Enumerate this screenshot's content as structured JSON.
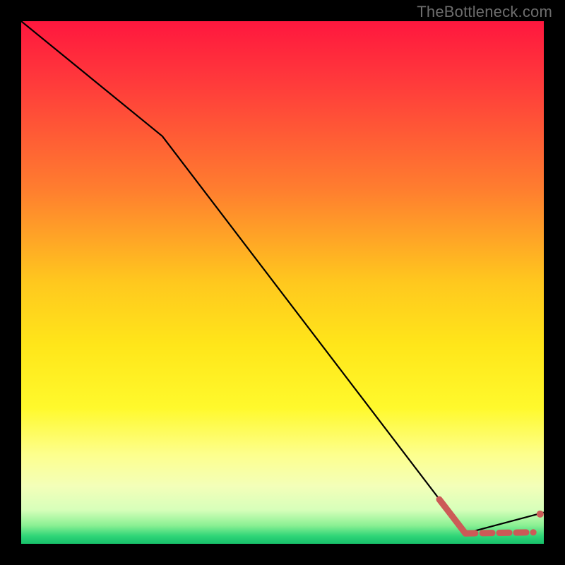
{
  "watermark": "TheBottleneck.com",
  "chart_data": {
    "type": "line",
    "title": "",
    "xlabel": "",
    "ylabel": "",
    "xlim": [
      0,
      100
    ],
    "ylim": [
      0,
      100
    ],
    "series": [
      {
        "name": "black-curve",
        "style": "solid",
        "color": "#000000",
        "x": [
          0,
          27,
          85,
          100
        ],
        "y": [
          100,
          78,
          2,
          6
        ]
      },
      {
        "name": "red-segment",
        "style": "solid-thick",
        "color": "#cc5a57",
        "x": [
          80,
          85
        ],
        "y": [
          8.5,
          2
        ]
      },
      {
        "name": "red-dashed",
        "style": "dashed-thick",
        "color": "#cc5a57",
        "x": [
          85,
          98
        ],
        "y": [
          2,
          2.2
        ]
      },
      {
        "name": "red-end-dot",
        "style": "dot",
        "color": "#cc5a57",
        "x": [
          99.3
        ],
        "y": [
          5.7
        ]
      }
    ],
    "gradient_stops": [
      {
        "offset": 0.0,
        "color": "#ff173e"
      },
      {
        "offset": 0.12,
        "color": "#ff3b3b"
      },
      {
        "offset": 0.32,
        "color": "#ff7d2f"
      },
      {
        "offset": 0.5,
        "color": "#ffc81e"
      },
      {
        "offset": 0.62,
        "color": "#ffe61a"
      },
      {
        "offset": 0.74,
        "color": "#fff92c"
      },
      {
        "offset": 0.83,
        "color": "#fdff8e"
      },
      {
        "offset": 0.89,
        "color": "#f3ffb9"
      },
      {
        "offset": 0.935,
        "color": "#d7ffba"
      },
      {
        "offset": 0.965,
        "color": "#8af093"
      },
      {
        "offset": 0.985,
        "color": "#2fd578"
      },
      {
        "offset": 1.0,
        "color": "#17c06a"
      }
    ]
  }
}
